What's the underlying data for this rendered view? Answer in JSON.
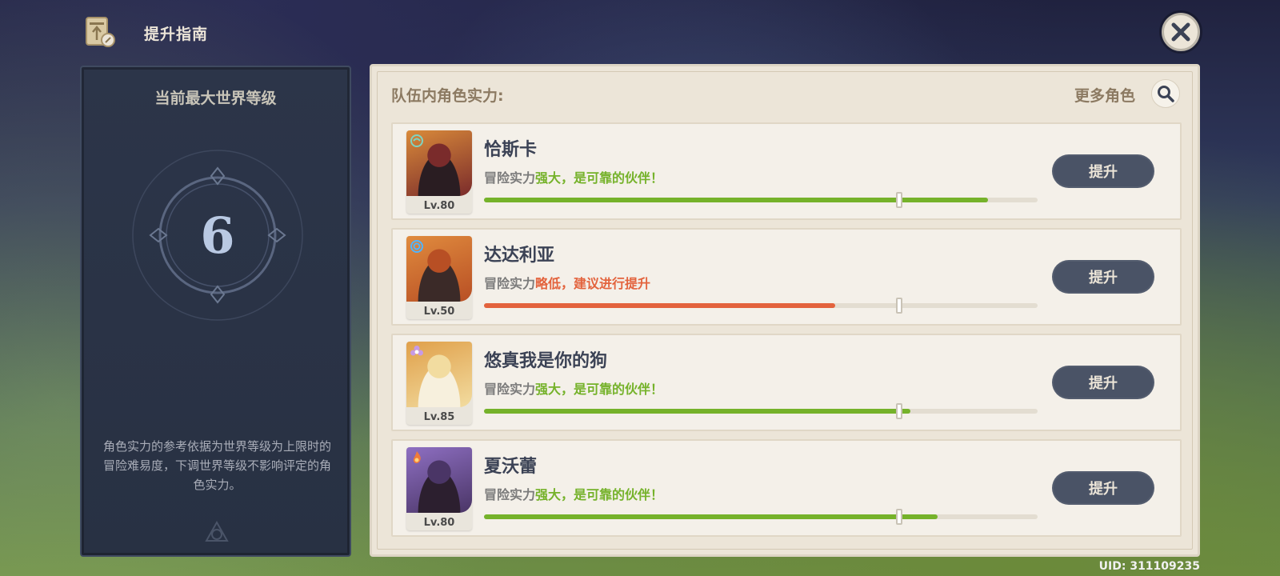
{
  "header": {
    "title": "提升指南",
    "guide_icon": "scroll-compass-icon",
    "close_icon": "close-icon"
  },
  "world": {
    "title": "当前最大世界等级",
    "level": "6",
    "note": "角色实力的参考依据为世界等级为上限时的冒险难易度，下调世界等级不影响评定的角色实力。"
  },
  "team": {
    "title": "队伍内角色实力:",
    "more_label": "更多角色",
    "search_icon": "search-icon",
    "characters": [
      {
        "name": "恰斯卡",
        "level": "Lv.80",
        "rating_prefix": "冒险实力",
        "rating_text": "强大，是可靠的伙伴！",
        "rating_status": "good",
        "progress": 0.91,
        "marker": 0.75,
        "button": "提升",
        "element_icon": "anemo-icon",
        "portrait_colors": [
          "#d98a3a",
          "#7a2b2b",
          "#2a1d22"
        ]
      },
      {
        "name": "达达利亚",
        "level": "Lv.50",
        "rating_prefix": "冒险实力",
        "rating_text": "略低，建议进行提升",
        "rating_status": "bad",
        "progress": 0.635,
        "marker": 0.75,
        "button": "提升",
        "element_icon": "hydro-icon",
        "portrait_colors": [
          "#e08b3e",
          "#b84f24",
          "#3b2a28"
        ]
      },
      {
        "name": "悠真我是你的狗",
        "level": "Lv.85",
        "rating_prefix": "冒险实力",
        "rating_text": "强大，是可靠的伙伴！",
        "rating_status": "good",
        "progress": 0.77,
        "marker": 0.75,
        "button": "提升",
        "element_icon": "flower-icon",
        "portrait_colors": [
          "#e0a04a",
          "#f2dca0",
          "#f7f0dd"
        ]
      },
      {
        "name": "夏沃蕾",
        "level": "Lv.80",
        "rating_prefix": "冒险实力",
        "rating_text": "强大，是可靠的伙伴！",
        "rating_status": "good",
        "progress": 0.82,
        "marker": 0.75,
        "button": "提升",
        "element_icon": "pyro-icon",
        "portrait_colors": [
          "#8e6fc2",
          "#4a3566",
          "#2c1f2f"
        ]
      }
    ]
  },
  "colors": {
    "good": "#75b22a",
    "bad": "#e3633d"
  },
  "uid": "UID: 311109235"
}
